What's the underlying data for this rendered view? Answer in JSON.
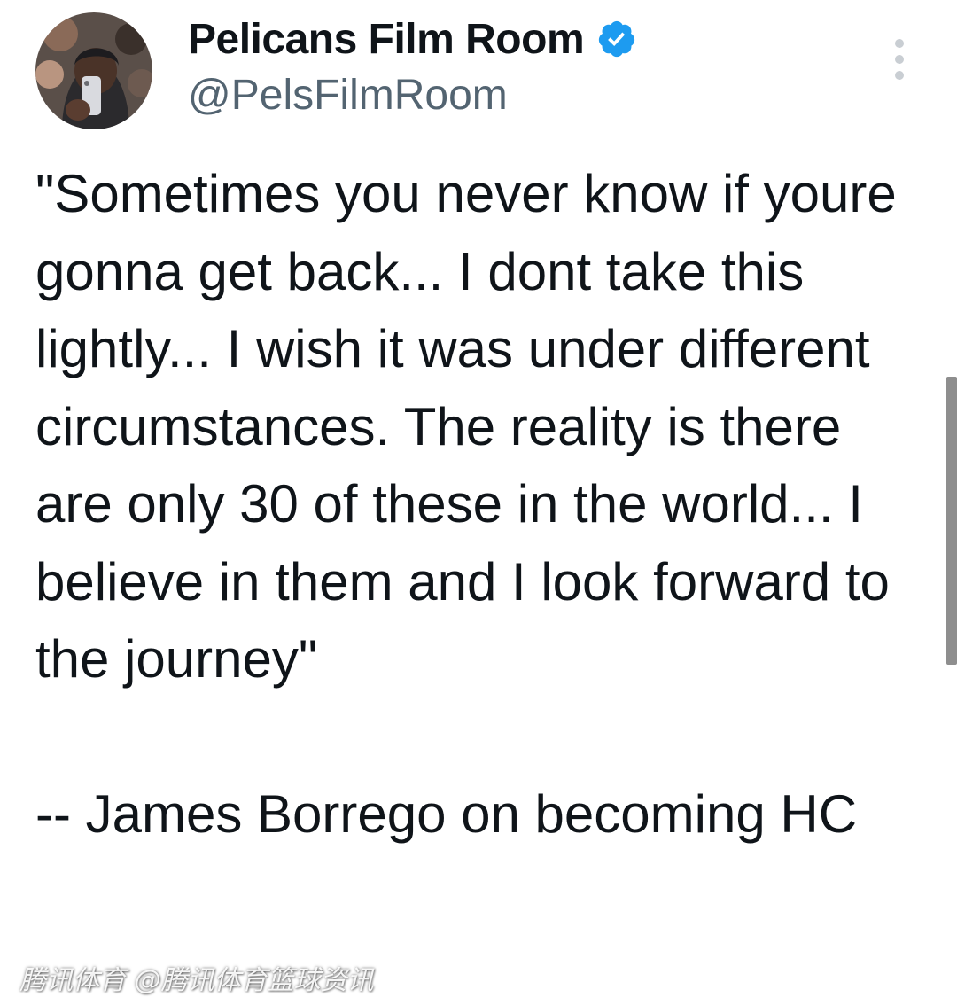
{
  "tweet": {
    "author": {
      "display_name": "Pelicans Film Room",
      "handle": "@PelsFilmRoom",
      "verified_icon": "verified-badge-icon",
      "avatar_icon": "profile-avatar"
    },
    "body": "\"Sometimes you never know if youre gonna get back... I dont take this lightly... I wish it was under different circumstances. The reality is there are only 30 of these in the world... I believe in them and I look forward to the journey\"\n\n-- James Borrego on becoming HC"
  },
  "more_menu": {
    "icon": "more-options-icon"
  },
  "watermark": {
    "text": "腾讯体育 @腾讯体育篮球资讯"
  },
  "colors": {
    "text_primary": "#0f1419",
    "text_secondary": "#536471",
    "verified_blue": "#1d9bf0",
    "background": "#ffffff"
  }
}
